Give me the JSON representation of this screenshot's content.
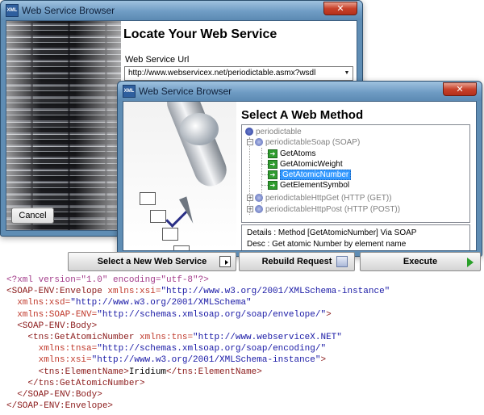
{
  "back_window": {
    "title": "Web Service Browser",
    "icon_label": "XML",
    "heading": "Locate Your Web Service",
    "url_label": "Web Service Url",
    "url_value": "http://www.webservicex.net/periodictable.asmx?wsdl",
    "cancel_label": "Cancel"
  },
  "front_window": {
    "title": "Web Service Browser",
    "icon_label": "XML",
    "heading": "Select A Web Method",
    "tree": {
      "root": "periodictable",
      "soap_binding": "periodictableSoap (SOAP)",
      "methods": [
        "GetAtoms",
        "GetAtomicWeight",
        "GetAtomicNumber",
        "GetElementSymbol"
      ],
      "selected_method": "GetAtomicNumber",
      "http_get": "periodictableHttpGet (HTTP (GET))",
      "http_post": "periodictableHttpPost (HTTP (POST))"
    },
    "details": {
      "line1": "Details : Method [GetAtomicNumber] Via SOAP",
      "line2": "Desc   : Get atomic Number by element name"
    }
  },
  "toolbar": {
    "select_label": "Select a New Web Service",
    "rebuild_label": "Rebuild Request",
    "execute_label": "Execute"
  },
  "xml_lines": [
    [
      [
        "decl",
        "<?xml version=\"1.0\" encoding=\"utf-8\"?>"
      ]
    ],
    [
      [
        "tag",
        "<SOAP-ENV:Envelope "
      ],
      [
        "attr",
        "xmlns:xsi="
      ],
      [
        "val",
        "\"http://www.w3.org/2001/XMLSchema-instance\""
      ]
    ],
    [
      [
        "text",
        "  "
      ],
      [
        "attr",
        "xmlns:xsd="
      ],
      [
        "val",
        "\"http://www.w3.org/2001/XMLSchema\""
      ]
    ],
    [
      [
        "text",
        "  "
      ],
      [
        "attr",
        "xmlns:SOAP-ENV="
      ],
      [
        "val",
        "\"http://schemas.xmlsoap.org/soap/envelope/\""
      ],
      [
        "tag",
        ">"
      ]
    ],
    [
      [
        "text",
        "  "
      ],
      [
        "tag",
        "<SOAP-ENV:Body>"
      ]
    ],
    [
      [
        "text",
        "    "
      ],
      [
        "tag",
        "<tns:GetAtomicNumber "
      ],
      [
        "attr",
        "xmlns:tns="
      ],
      [
        "val",
        "\"http://www.webserviceX.NET\""
      ]
    ],
    [
      [
        "text",
        "      "
      ],
      [
        "attr",
        "xmlns:tnsa="
      ],
      [
        "val",
        "\"http://schemas.xmlsoap.org/soap/encoding/\""
      ]
    ],
    [
      [
        "text",
        "      "
      ],
      [
        "attr",
        "xmlns:xsi="
      ],
      [
        "val",
        "\"http://www.w3.org/2001/XMLSchema-instance\""
      ],
      [
        "tag",
        ">"
      ]
    ],
    [
      [
        "text",
        "      "
      ],
      [
        "tag",
        "<tns:ElementName>"
      ],
      [
        "text",
        "Iridium"
      ],
      [
        "tag",
        "</tns:ElementName>"
      ]
    ],
    [
      [
        "text",
        "    "
      ],
      [
        "tag",
        "</tns:GetAtomicNumber>"
      ]
    ],
    [
      [
        "text",
        "  "
      ],
      [
        "tag",
        "</SOAP-ENV:Body>"
      ]
    ],
    [
      [
        "tag",
        "</SOAP-ENV:Envelope>"
      ]
    ]
  ]
}
